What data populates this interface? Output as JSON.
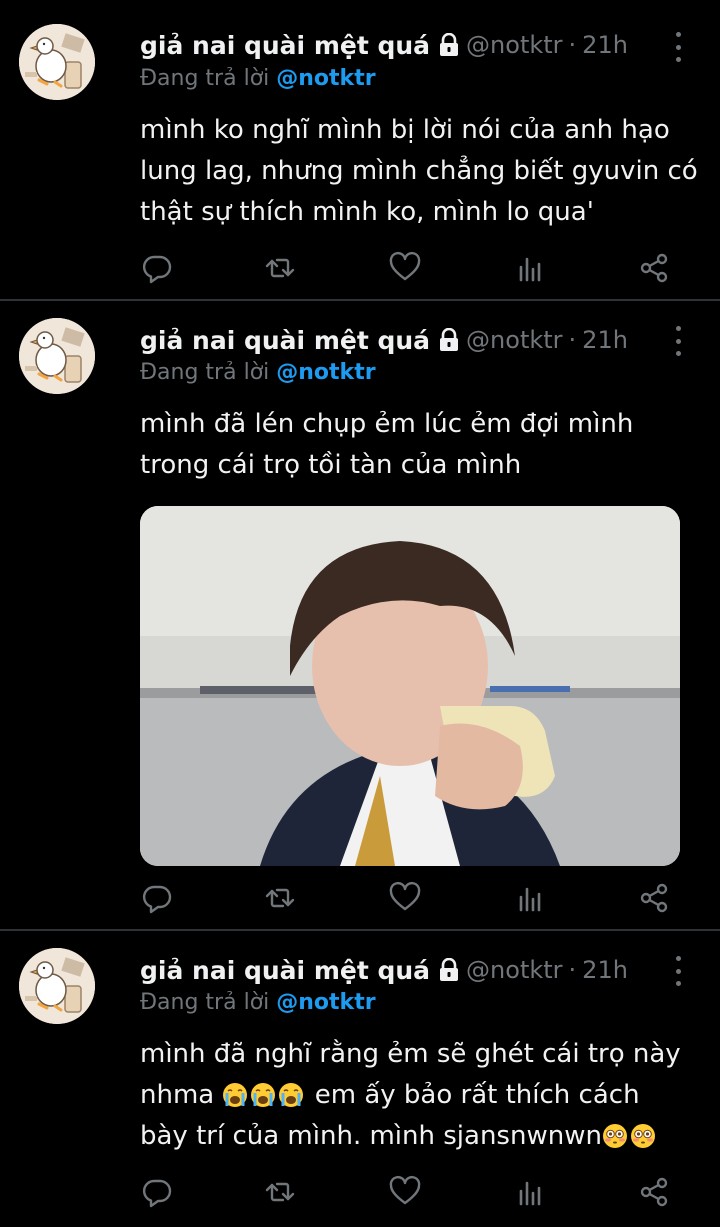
{
  "tweets": [
    {
      "display_name": "giả nai quài mệt quá",
      "handle": "@notktr",
      "separator": "·",
      "time": "21h",
      "reply_prefix": "Đang trả lời",
      "reply_to": "@notktr",
      "text_lines": [
        "mình ko nghĩ mình bị lời nói của anh hạo",
        "lung lag, nhưng mình chẳng biết gyuvin có",
        "thật sự thích mình ko, mình lo qua'"
      ]
    },
    {
      "display_name": "giả nai quài mệt quá",
      "handle": "@notktr",
      "separator": "·",
      "time": "21h",
      "reply_prefix": "Đang trả lời",
      "reply_to": "@notktr",
      "text_lines": [
        "mình đã lén chụp ẻm lúc ẻm đợi mình",
        "trong cái trọ tồi tàn của mình"
      ],
      "has_photo": true
    },
    {
      "display_name": "giả nai quài mệt quá",
      "handle": "@notktr",
      "separator": "·",
      "time": "21h",
      "reply_prefix": "Đang trả lời",
      "reply_to": "@notktr",
      "line1": "mình đã nghĩ rằng ẻm sẽ ghét cái trọ này",
      "line2_prefix": "nhma",
      "line2_suffix": "em ấy bảo rất thích cách",
      "line3": "bày trí của mình. mình sjansnwnwn",
      "emojis": [
        "loudly-crying-face",
        "flushed-face"
      ]
    }
  ],
  "actions": [
    "reply-icon",
    "retweet-icon",
    "like-icon",
    "analytics-icon",
    "share-icon"
  ],
  "colors": {
    "background": "#000000",
    "text": "#e7e9ea",
    "muted": "#71767b",
    "link": "#1d9bf0",
    "divider": "#2f3336"
  }
}
